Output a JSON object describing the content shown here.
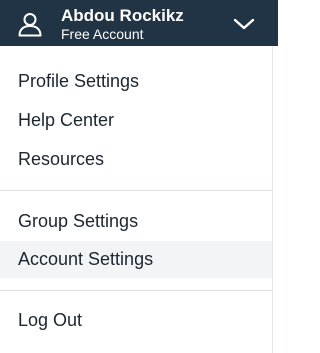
{
  "header": {
    "user_name": "Abdou Rockikz",
    "plan": "Free Account",
    "user_icon": "user-icon",
    "toggle_icon": "chevron-down-icon",
    "background": "#213445"
  },
  "menu": {
    "group1": [
      "Profile Settings",
      "Help Center",
      "Resources"
    ],
    "group2": [
      "Group Settings",
      "Account Settings"
    ],
    "group3": [
      "Log Out"
    ],
    "active_item": "Account Settings",
    "active_background": "#f2f4f6"
  }
}
